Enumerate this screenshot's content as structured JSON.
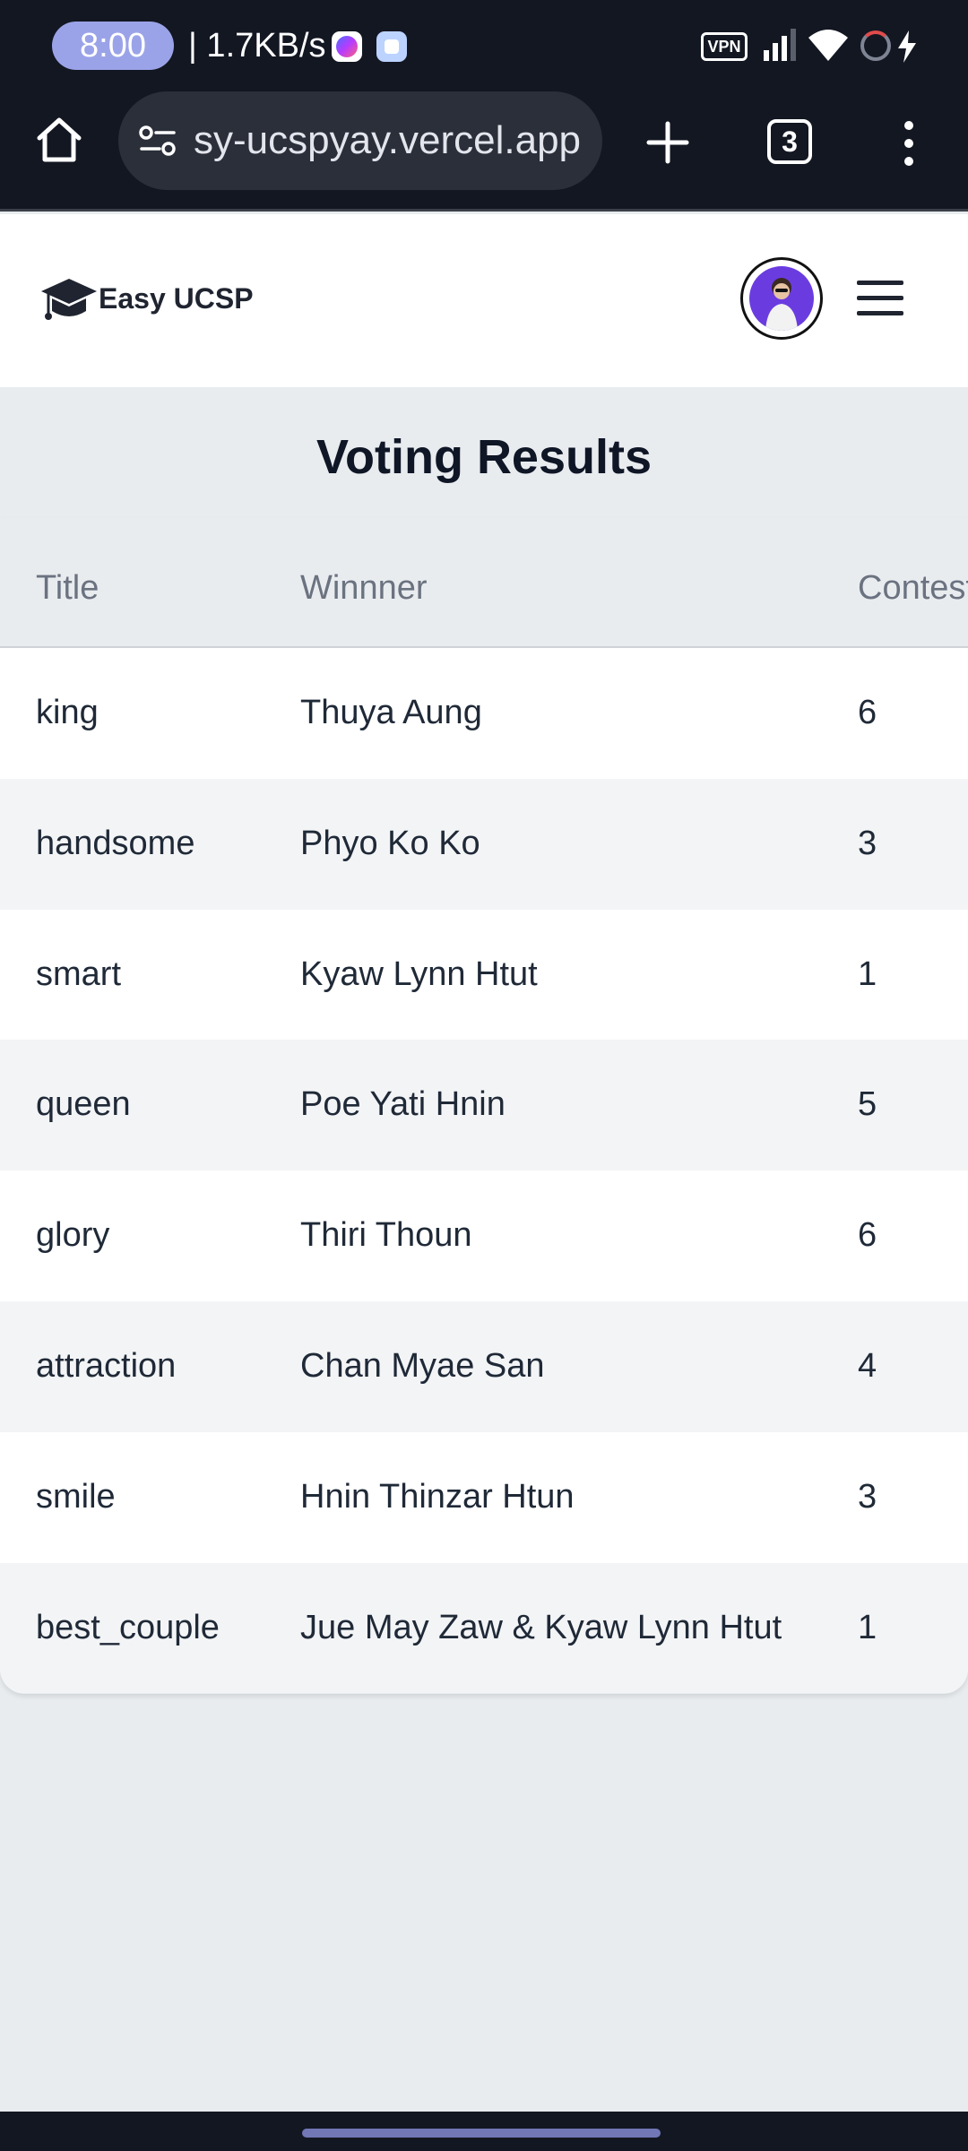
{
  "status_bar": {
    "time": "8:00",
    "net_speed": "| 1.7KB/s",
    "vpn_label": "VPN",
    "icons": [
      "messenger-icon",
      "app-notification-icon",
      "vpn-icon",
      "signal-icon",
      "wifi-icon",
      "battery-icon",
      "charging-icon"
    ]
  },
  "browser": {
    "url": "sy-ucspyay.vercel.app",
    "tab_count": "3",
    "icons": [
      "home-icon",
      "site-settings-icon",
      "new-tab-icon",
      "tab-switcher-icon",
      "more-menu-icon"
    ]
  },
  "header": {
    "logo_text": "Easy UCSP",
    "icons": [
      "graduation-cap-icon",
      "avatar",
      "hamburger-menu-icon"
    ]
  },
  "page": {
    "title": "Voting Results"
  },
  "table": {
    "columns": [
      "Title",
      "Winnner",
      "Contest"
    ],
    "rows": [
      {
        "title": "king",
        "winner": "Thuya Aung",
        "count": "6"
      },
      {
        "title": "handsome",
        "winner": "Phyo Ko Ko",
        "count": "3"
      },
      {
        "title": "smart",
        "winner": "Kyaw Lynn Htut",
        "count": "1"
      },
      {
        "title": "queen",
        "winner": "Poe Yati Hnin",
        "count": "5"
      },
      {
        "title": "glory",
        "winner": "Thiri Thoun",
        "count": "6"
      },
      {
        "title": "attraction",
        "winner": "Chan Myae San",
        "count": "4"
      },
      {
        "title": "smile",
        "winner": "Hnin Thinzar Htun",
        "count": "3"
      },
      {
        "title": "best_couple",
        "winner": "Jue May Zaw & Kyaw Lynn Htut",
        "count": "1"
      }
    ]
  },
  "colors": {
    "system_bar": "#131722",
    "page_background": "#e9ecef",
    "title_text": "#0f1626",
    "header_text": "#6b7280",
    "row_alt": "#f3f4f6"
  }
}
